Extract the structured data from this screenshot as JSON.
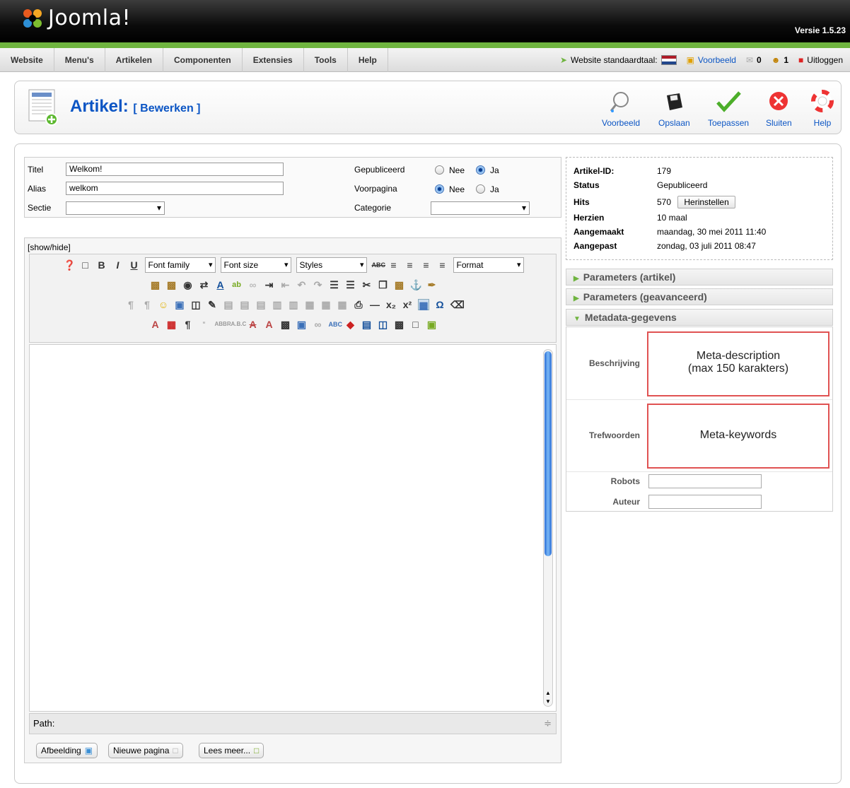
{
  "header": {
    "brand": "Joomla!",
    "version": "Versie 1.5.23"
  },
  "menu": {
    "items": [
      "Website",
      "Menu's",
      "Artikelen",
      "Componenten",
      "Extensies",
      "Tools",
      "Help"
    ]
  },
  "status": {
    "lang_label": "Website standaardtaal:",
    "preview": "Voorbeeld",
    "messages": "0",
    "users": "1",
    "logout": "Uitloggen"
  },
  "page": {
    "title": "Artikel:",
    "subtitle": "[ Bewerken ]"
  },
  "toolbar": {
    "preview": "Voorbeeld",
    "save": "Opslaan",
    "apply": "Toepassen",
    "close": "Sluiten",
    "help": "Help"
  },
  "form": {
    "title_label": "Titel",
    "title_value": "Welkom!",
    "alias_label": "Alias",
    "alias_value": "welkom",
    "section_label": "Sectie",
    "published_label": "Gepubliceerd",
    "frontpage_label": "Voorpagina",
    "category_label": "Categorie",
    "no": "Nee",
    "yes": "Ja",
    "published": "Ja",
    "frontpage": "Nee"
  },
  "editor": {
    "showhide": "[show/hide]",
    "font_family": "Font family",
    "font_size": "Font size",
    "styles": "Styles",
    "format": "Format",
    "path_label": "Path:",
    "btn_image": "Afbeelding",
    "btn_pagebreak": "Nieuwe pagina",
    "btn_readmore": "Lees meer..."
  },
  "info": {
    "id_label": "Artikel-ID:",
    "id_value": "179",
    "status_label": "Status",
    "status_value": "Gepubliceerd",
    "hits_label": "Hits",
    "hits_value": "570",
    "reset": "Herinstellen",
    "revised_label": "Herzien",
    "revised_value": "10 maal",
    "created_label": "Aangemaakt",
    "created_value": "maandag, 30 mei 2011 11:40",
    "modified_label": "Aangepast",
    "modified_value": "zondag, 03 juli 2011 08:47"
  },
  "panels": {
    "params_article": "Parameters (artikel)",
    "params_advanced": "Parameters (geavanceerd)",
    "metadata": "Metadata-gegevens"
  },
  "metadata": {
    "desc_label": "Beschrijving",
    "desc_line1": "Meta-description",
    "desc_line2": "(max 150 karakters)",
    "keywords_label": "Trefwoorden",
    "keywords_value": "Meta-keywords",
    "robots_label": "Robots",
    "author_label": "Auteur"
  },
  "colors": {
    "accent": "#0b55c4",
    "green": "#6fb43f",
    "highlight": "#e05252"
  }
}
